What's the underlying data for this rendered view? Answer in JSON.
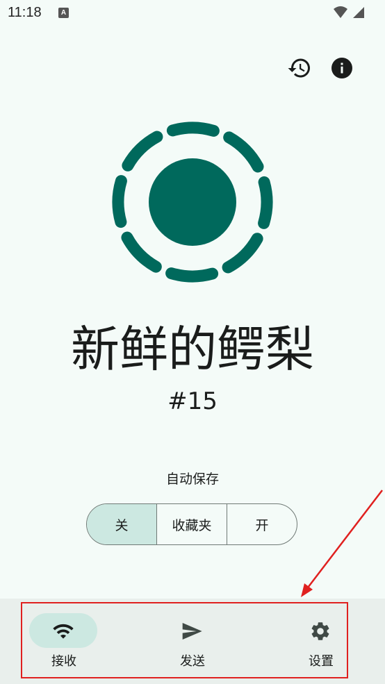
{
  "status_bar": {
    "time": "11:18",
    "notification_glyph": "A"
  },
  "toolbar": {
    "history_icon": "history-icon",
    "info_icon": "info-icon"
  },
  "logo": {
    "color": "#00695c"
  },
  "device": {
    "name": "新鲜的鳄梨",
    "number": "#15"
  },
  "autosave": {
    "label": "自动保存",
    "options": [
      {
        "label": "关",
        "selected": true
      },
      {
        "label": "收藏夹",
        "selected": false
      },
      {
        "label": "开",
        "selected": false
      }
    ]
  },
  "bottom_nav": {
    "items": [
      {
        "label": "接收",
        "icon": "wifi-icon",
        "active": true
      },
      {
        "label": "发送",
        "icon": "send-icon",
        "active": false
      },
      {
        "label": "设置",
        "icon": "gear-icon",
        "active": false
      }
    ]
  },
  "colors": {
    "accent": "#00695c",
    "selected_bg": "#cce8e1",
    "annotation": "#e0201f"
  }
}
